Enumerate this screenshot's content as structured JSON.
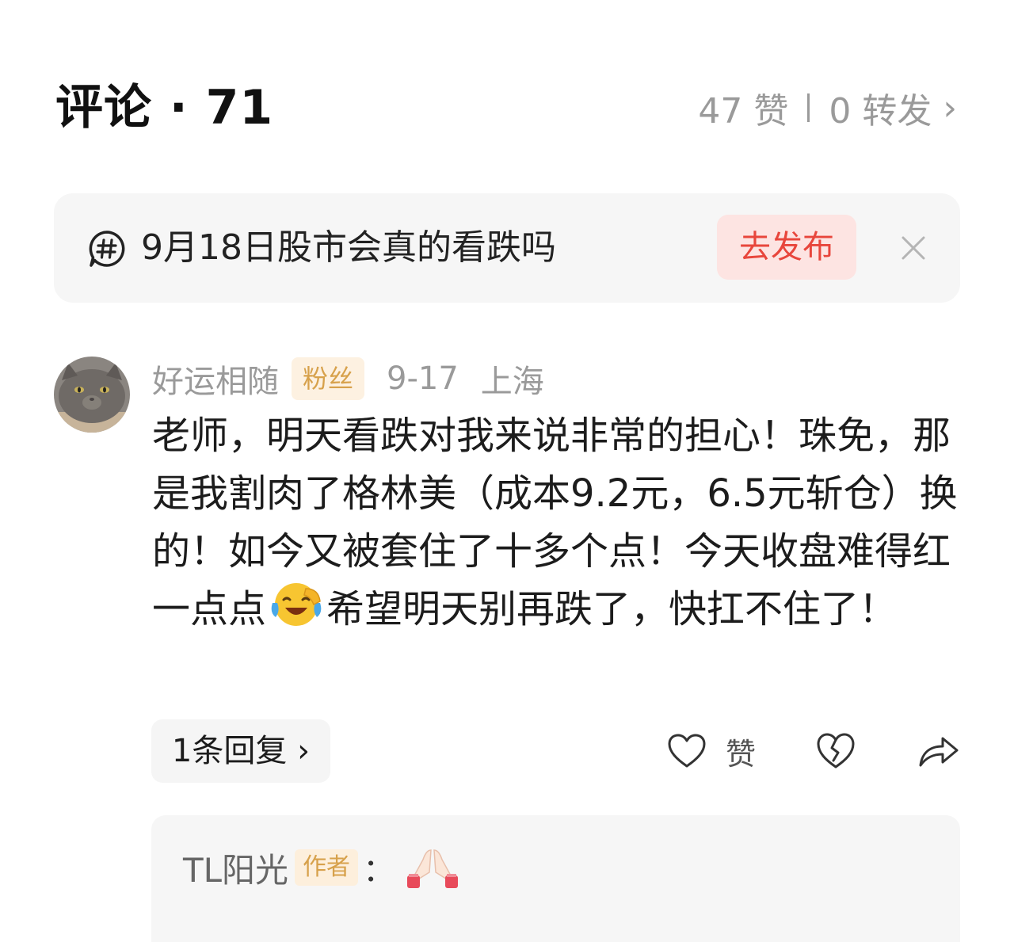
{
  "header": {
    "title": "评论 · 71",
    "likes": "47 赞",
    "reposts": "0 转发",
    "chevron": "›"
  },
  "topic": {
    "icon": "hashtag-chat-icon",
    "text": "9月18日股市会真的看跌吗",
    "publish_label": "去发布",
    "close_icon": "close-icon"
  },
  "comment": {
    "avatar": "cat-avatar",
    "username": "好运相随",
    "badge": "粉丝",
    "date": "9-17",
    "location": "上海",
    "text_before_emoji": "老师，明天看跌对我来说非常的担心！珠免，那是我割肉了格林美（成本9.2元，6.5元斩仓）换的！如今又被套住了十多个点！今天收盘难得红一点点",
    "emoji": "laughing-tears-emoji",
    "text_after_emoji": "希望明天别再跌了，快扛不住了！",
    "reply_count_label": "1条回复 ›",
    "like_label": "赞",
    "like_icon": "heart-icon",
    "dislike_icon": "broken-heart-icon",
    "share_icon": "share-icon"
  },
  "reply": {
    "username": "TL阳光",
    "badge": "作者",
    "colon": "：",
    "emoji": "praying-hands-emoji"
  },
  "colors": {
    "accent_red": "#e8463c",
    "badge_gold": "#d7a14b",
    "muted_text": "#9a9a9a"
  }
}
